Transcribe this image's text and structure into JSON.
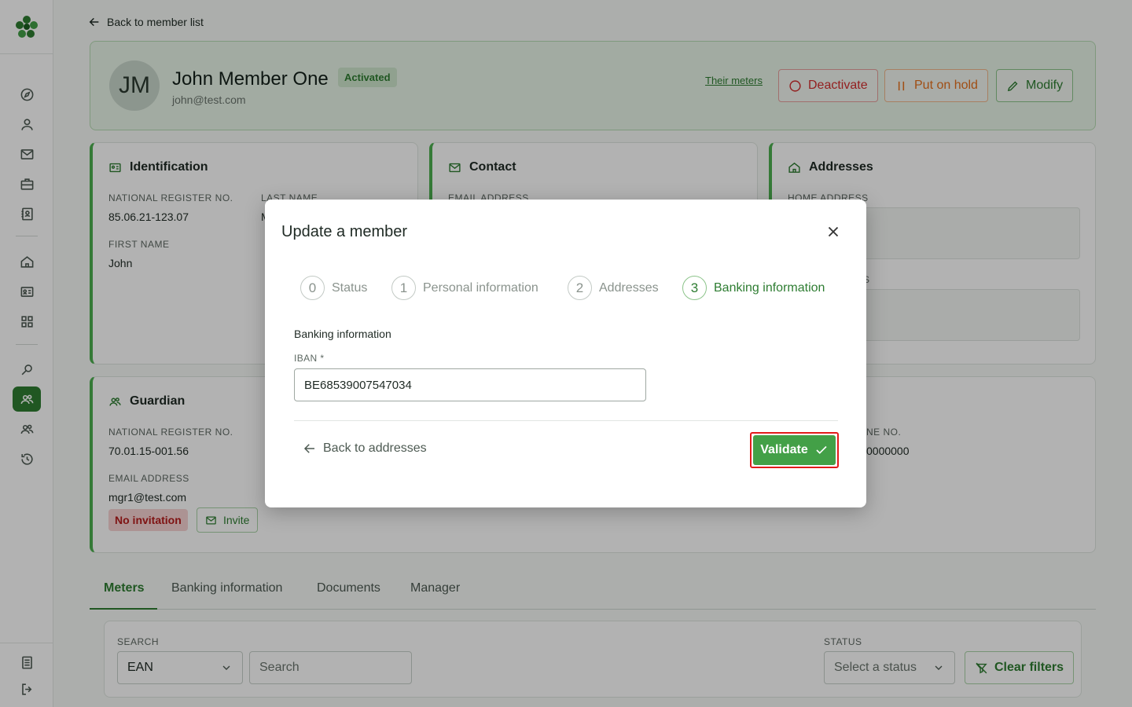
{
  "nav": {
    "back_label": "Back to member list"
  },
  "member": {
    "initials": "JM",
    "name": "John Member One",
    "status": "Activated",
    "email": "john@test.com",
    "meters_link": "Their meters",
    "actions": {
      "deactivate": "Deactivate",
      "hold": "Put on hold",
      "modify": "Modify"
    }
  },
  "identification": {
    "title": "Identification",
    "national_register_label": "NATIONAL REGISTER NO.",
    "national_register_value": "85.06.21-123.07",
    "last_name_label": "LAST NAME",
    "last_name_value": "M",
    "first_name_label": "FIRST NAME",
    "first_name_value": "John"
  },
  "contact": {
    "title": "Contact",
    "email_label": "EMAIL ADDRESS"
  },
  "addresses": {
    "title": "Addresses",
    "home_label": "HOME ADDRESS",
    "billing_label_fragment": "S"
  },
  "guardian": {
    "title": "Guardian",
    "national_register_label": "NATIONAL REGISTER NO.",
    "national_register_value": "70.01.15-001.56",
    "email_label": "EMAIL ADDRESS",
    "email_value": "mgr1@test.com",
    "invitation_status": "No invitation",
    "invite_label": "Invite",
    "phone_label_fragment": "NE NO.",
    "phone_value_fragment": "0000000"
  },
  "tabs": [
    "Meters",
    "Banking information",
    "Documents",
    "Manager"
  ],
  "filters": {
    "search_label": "SEARCH",
    "search_type": "EAN",
    "search_placeholder": "Search",
    "status_label": "STATUS",
    "status_placeholder": "Select a status",
    "clear_label": "Clear filters"
  },
  "modal": {
    "title": "Update a member",
    "steps": [
      {
        "number": "0",
        "label": "Status"
      },
      {
        "number": "1",
        "label": "Personal information"
      },
      {
        "number": "2",
        "label": "Addresses"
      },
      {
        "number": "3",
        "label": "Banking information"
      }
    ],
    "section_label": "Banking information",
    "iban_label": "IBAN *",
    "iban_value": "BE68539007547034",
    "back_label": "Back to addresses",
    "validate_label": "Validate"
  },
  "colors": {
    "primary": "#2e7d32",
    "danger": "#d32f2f",
    "warning": "#e6701e",
    "highlight": "#e21b1b"
  }
}
